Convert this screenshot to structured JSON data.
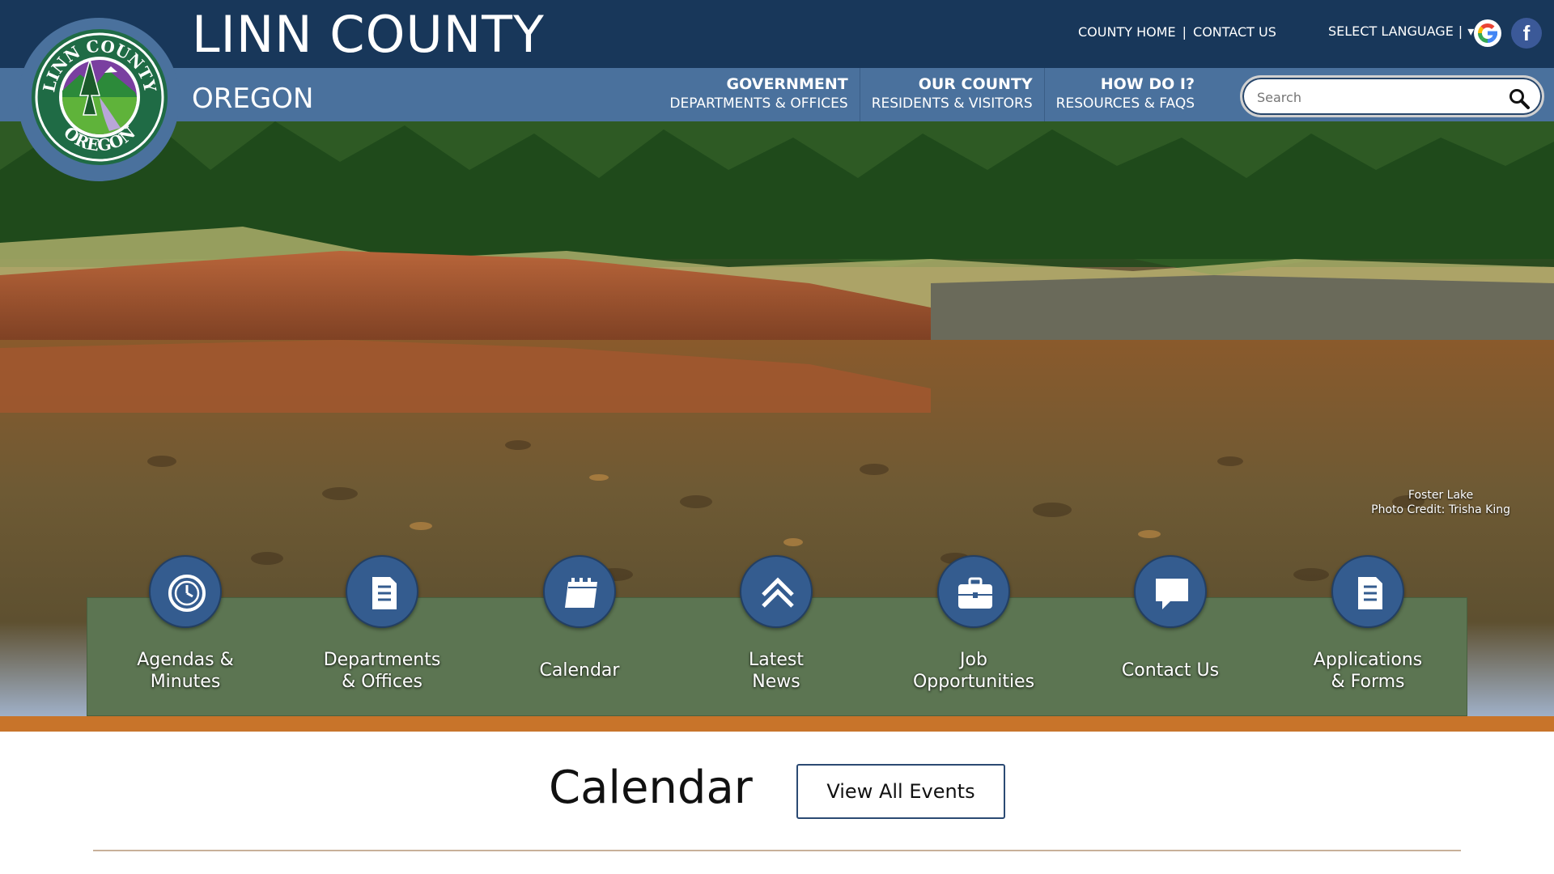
{
  "header": {
    "title": "LINN COUNTY",
    "subtitle": "OREGON",
    "seal_text_top": "LINN COUNTY",
    "seal_text_bottom": "OREGON",
    "util_links": [
      "COUNTY HOME",
      "CONTACT US"
    ],
    "util_separator": "|",
    "language_label": "SELECT LANGUAGE",
    "language_separator": "|",
    "language_arrow": "▾",
    "facebook_glyph": "f",
    "icons": [
      "google-translate-icon",
      "facebook-icon",
      "search-icon"
    ]
  },
  "nav": [
    {
      "title": "GOVERNMENT",
      "sub": "DEPARTMENTS & OFFICES"
    },
    {
      "title": "OUR COUNTY",
      "sub": "RESIDENTS & VISITORS"
    },
    {
      "title": "HOW DO I?",
      "sub": "RESOURCES & FAQS"
    }
  ],
  "search": {
    "placeholder": "Search"
  },
  "hero": {
    "credit_line1": "Foster Lake",
    "credit_line2": "Photo Credit: Trisha King"
  },
  "quick_links": [
    {
      "line1": "Agendas &",
      "line2": "Minutes",
      "icon": "clock-icon"
    },
    {
      "line1": "Departments",
      "line2": "& Offices",
      "icon": "document-icon"
    },
    {
      "line1": "Calendar",
      "line2": "",
      "icon": "calendar-icon"
    },
    {
      "line1": "Latest",
      "line2": "News",
      "icon": "chevron-up-icon"
    },
    {
      "line1": "Job",
      "line2": "Opportunities",
      "icon": "briefcase-icon"
    },
    {
      "line1": "Contact Us",
      "line2": "",
      "icon": "chat-bubble-icon"
    },
    {
      "line1": "Applications",
      "line2": "& Forms",
      "icon": "document-icon"
    }
  ],
  "calendar": {
    "title": "Calendar",
    "button": "View All Events"
  },
  "colors": {
    "topbar": "#18375a",
    "navbar": "#4a719d",
    "quickbar": "#5c7552",
    "accent_orange": "#c8742a",
    "icon_circle": "#345c8f"
  }
}
